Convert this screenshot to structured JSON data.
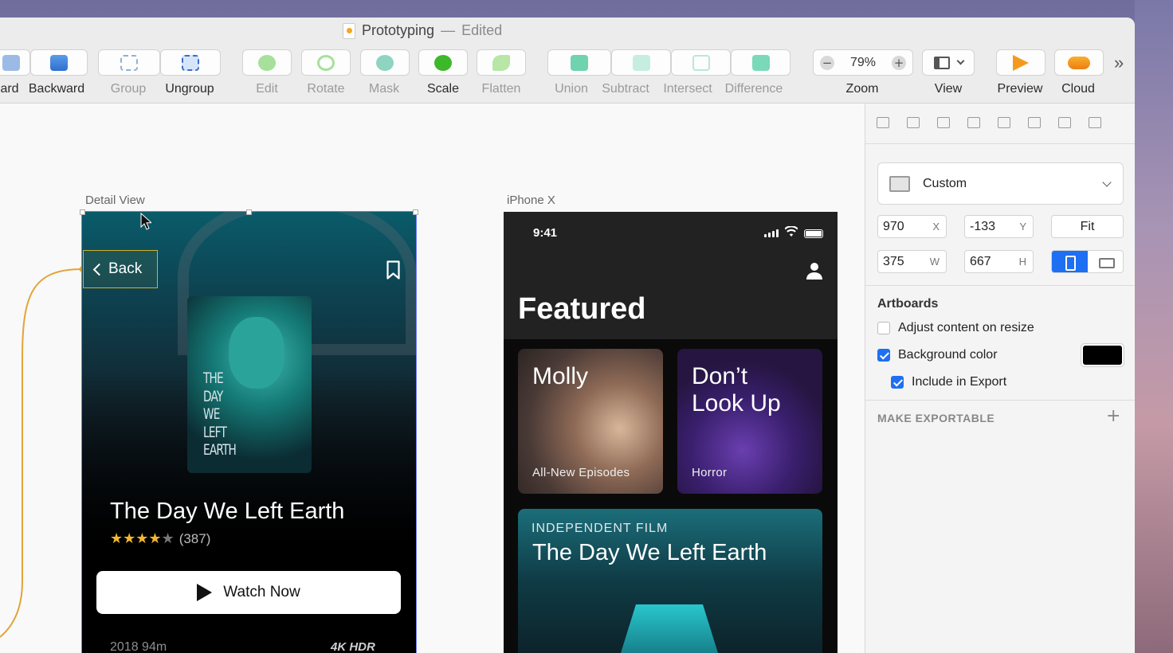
{
  "window": {
    "title": "Prototyping",
    "separator": " — ",
    "status": "Edited"
  },
  "toolbar": {
    "items": [
      {
        "label": "ard",
        "dim": false
      },
      {
        "label": "Backward",
        "dim": false
      },
      {
        "label": "Group",
        "dim": true
      },
      {
        "label": "Ungroup",
        "dim": false
      },
      {
        "label": "Edit",
        "dim": true
      },
      {
        "label": "Rotate",
        "dim": true
      },
      {
        "label": "Mask",
        "dim": true
      },
      {
        "label": "Scale",
        "dim": false
      },
      {
        "label": "Flatten",
        "dim": true
      },
      {
        "label": "Union",
        "dim": true
      },
      {
        "label": "Subtract",
        "dim": true
      },
      {
        "label": "Intersect",
        "dim": true
      },
      {
        "label": "Difference",
        "dim": true
      },
      {
        "label": "Zoom",
        "dim": false
      },
      {
        "label": "View",
        "dim": false
      },
      {
        "label": "Preview",
        "dim": false
      },
      {
        "label": "Cloud",
        "dim": false
      }
    ],
    "zoom_value": "79%",
    "zoom_minus": "−",
    "zoom_plus": "+",
    "overflow": "»"
  },
  "canvas": {
    "detail_view": {
      "label": "Detail View",
      "back_label": "Back",
      "poster_title": [
        "THE",
        "DAY",
        "WE",
        "LEFT",
        "EARTH"
      ],
      "title": "The Day We Left Earth",
      "rating_stars": "★★★★",
      "rating_off": "★",
      "rating_count": "(387)",
      "rating_value": 4,
      "cta": "Watch Now",
      "meta": "2018   94m",
      "badges": "4K  HDR"
    },
    "iphone_x": {
      "label": "iPhone X",
      "time": "9:41",
      "heading": "Featured",
      "cards": [
        {
          "title": "Molly",
          "subtitle": "All-New Episodes"
        },
        {
          "title": "Don’t Look Up",
          "title_lines": [
            "Don’t",
            "Look Up"
          ],
          "subtitle": "Horror"
        }
      ],
      "banner": {
        "kicker": "INDEPENDENT FILM",
        "title": "The Day We Left Earth"
      }
    },
    "link_color": "#e2a43a"
  },
  "inspector": {
    "preset": "Custom",
    "x": {
      "value": "970",
      "suffix": "X"
    },
    "y": {
      "value": "-133",
      "suffix": "Y"
    },
    "w": {
      "value": "375",
      "suffix": "W"
    },
    "h": {
      "value": "667",
      "suffix": "H"
    },
    "fit_label": "Fit",
    "artboards_heading": "Artboards",
    "options": [
      {
        "label": "Adjust content on resize",
        "checked": false
      },
      {
        "label": "Background color",
        "checked": true
      },
      {
        "label": "Include in Export",
        "checked": true
      }
    ],
    "background_color": "#000000",
    "make_exportable": "MAKE EXPORTABLE",
    "add_symbol": "+"
  },
  "colors": {
    "accent": "#1e6ff2",
    "selection": "#6b7cff",
    "back_highlight": "#d3b02e",
    "star": "#f2b632"
  }
}
